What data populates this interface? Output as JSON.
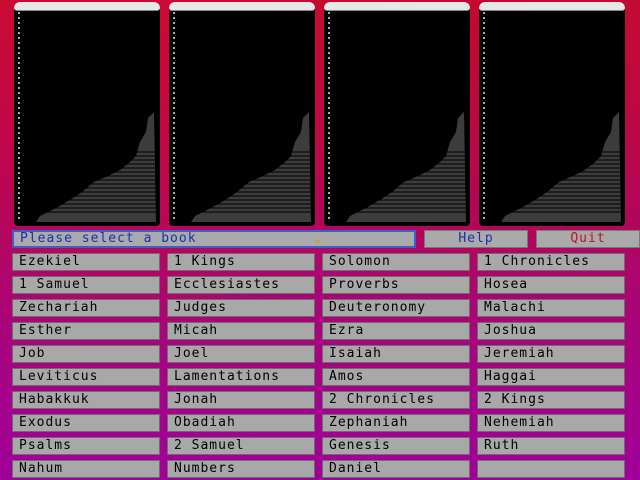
{
  "status": {
    "prompt": "Please select a book"
  },
  "buttons": {
    "help": "Help",
    "quit": "Quit"
  },
  "colors": {
    "background": "#b0006a",
    "status_text": "#1a2fb0",
    "help_text": "#1a2fb0",
    "quit_text": "#c0102a"
  },
  "columns": [
    [
      "Ezekiel",
      "1 Samuel",
      "Zechariah",
      "Esther",
      "Job",
      "Leviticus",
      "Habakkuk",
      "Exodus",
      "Psalms",
      "Nahum"
    ],
    [
      "1 Kings",
      "Ecclesiastes",
      "Judges",
      "Micah",
      "Joel",
      "Lamentations",
      "Jonah",
      "Obadiah",
      "2 Samuel",
      "Numbers"
    ],
    [
      "Solomon",
      "Proverbs",
      "Deuteronomy",
      "Ezra",
      "Isaiah",
      "Amos",
      "2 Chronicles",
      "Zephaniah",
      "Genesis",
      "Daniel"
    ],
    [
      "1 Chronicles",
      "Hosea",
      "Malachi",
      "Joshua",
      "Jeremiah",
      "Haggai",
      "2 Kings",
      "Nehemiah",
      "Ruth",
      ""
    ]
  ]
}
